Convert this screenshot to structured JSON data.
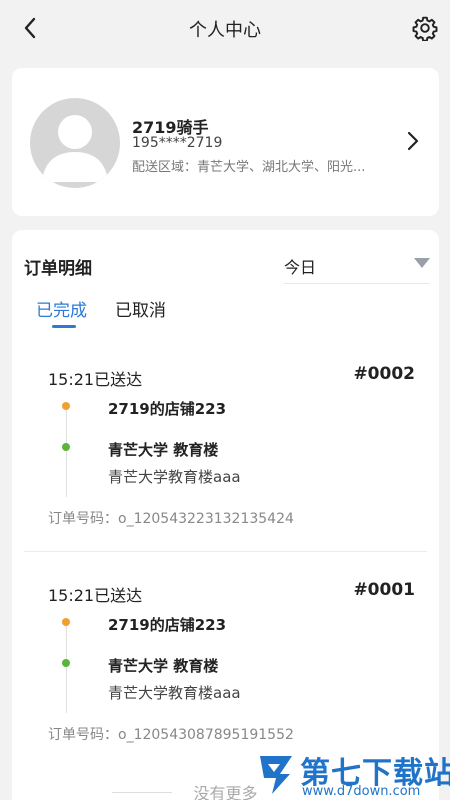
{
  "header": {
    "title": "个人中心",
    "back_icon": "chevron-left-icon",
    "settings_icon": "gear-icon"
  },
  "profile": {
    "name": "2719骑手",
    "phone": "195****2719",
    "area": "配送区域：青芒大学、湖北大学、阳光...",
    "avatar_icon": "avatar-placeholder-icon",
    "chevron_icon": "chevron-right-icon"
  },
  "orders": {
    "title": "订单明细",
    "date_filter": "今日",
    "tabs": [
      {
        "label": "已完成",
        "active": true
      },
      {
        "label": "已取消",
        "active": false
      }
    ],
    "list": [
      {
        "time": "15:21已送达",
        "number": "#0002",
        "shop": "2719的店铺223",
        "destination": "青芒大学 教育楼",
        "destination_detail": "青芒大学教育楼aaa",
        "order_no": "订单号码：o_120543223132135424"
      },
      {
        "time": "15:21已送达",
        "number": "#0001",
        "shop": "2719的店铺223",
        "destination": "青芒大学 教育楼",
        "destination_detail": "青芒大学教育楼aaa",
        "order_no": "订单号码：o_120543087895191552"
      }
    ],
    "no_more": "没有更多"
  },
  "watermark": {
    "name": "第七下载站",
    "url": "www.d7down.com"
  },
  "colors": {
    "accent": "#2b7bd6",
    "shop_dot": "#f0a030",
    "dest_dot": "#5bb53a",
    "background": "#f2f2f2",
    "watermark": "#1f74c9"
  }
}
